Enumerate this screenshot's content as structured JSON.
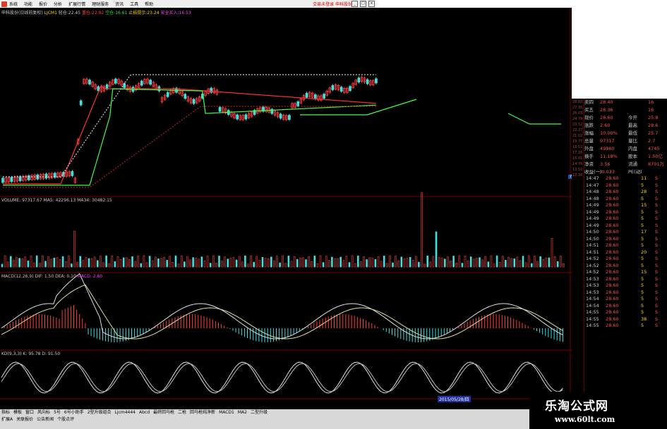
{
  "menubar": {
    "items": [
      "系统",
      "功能",
      "报价",
      "分析",
      "扩展行情",
      "理财服务",
      "资讯",
      "工具",
      "帮助"
    ],
    "right_text": "交易未登录 申科股份"
  },
  "price_panel": {
    "title": "申科股份(日线前复权)",
    "indicator_label": "LJCM1",
    "a_label": "轻仓",
    "a_val": "22.45",
    "b_label": "重仓",
    "b_val": "22.92",
    "c_label": "空仓",
    "c_val": "16.61",
    "d_label": "止损提示",
    "d_val": "23.24",
    "e_label": "安全买入",
    "e_val": "16.53"
  },
  "volume_panel": {
    "label": "VOLUME",
    "vol": "97317.67",
    "ma5_label": "MA5",
    "ma5": "42296.13",
    "ma34_label": "MA34",
    "ma34": "30482.15"
  },
  "macd_panel": {
    "label": "MACD(12,26,9)",
    "dif_label": "DIF",
    "dif": "1.50",
    "dea_label": "DEA",
    "dea": "0.10",
    "macd_label": "MACD",
    "macd": "2.80"
  },
  "kdj_panel": {
    "label": "KD(9,3,3)",
    "k_label": "K",
    "k": "95.78",
    "d_label": "D",
    "d": "91.50"
  },
  "axis_ticks": [
    "28.60",
    "27.35",
    "26.03",
    "24.79",
    "23.52",
    "22.27",
    "21.02",
    "19.77",
    "18.52",
    "17.26",
    "16.01",
    "14.76",
    "13.51",
    "12.26"
  ],
  "marker": "7.98",
  "quote": [
    {
      "l1": "卖四",
      "v1": "28.40",
      "r1": "",
      "r2": "16"
    },
    {
      "l1": "买五",
      "v1": "28.36",
      "r1": "",
      "r2": "16"
    },
    {
      "l1": "现价",
      "v1": "28.60",
      "r1": "今开",
      "r2": "25.8"
    },
    {
      "l1": "涨跌",
      "v1": "2.60",
      "r1": "最高",
      "r2": "28.6"
    },
    {
      "l1": "涨幅",
      "v1": "10.00%",
      "r1": "最低",
      "r2": "25.7"
    },
    {
      "l1": "总量",
      "v1": "97317",
      "r1": "量比",
      "r2": "2.7"
    },
    {
      "l1": "外盘",
      "v1": "49860",
      "r1": "内盘",
      "r2": "4745"
    },
    {
      "l1": "换手",
      "v1": "11.18%",
      "r1": "股本",
      "r2": "1.50亿"
    },
    {
      "l1": "净资",
      "v1": "3.56",
      "r1": "流通",
      "r2": "8701万"
    },
    {
      "l1": "收益(一)",
      "v1": "-0.033",
      "r1": "PE(动)",
      "r2": ""
    }
  ],
  "ticks": [
    {
      "t": "14:47",
      "p": "28.60",
      "v": "11",
      "d": "S"
    },
    {
      "t": "14:47",
      "p": "28.60",
      "v": "5",
      "d": "S"
    },
    {
      "t": "14:48",
      "p": "28.60",
      "v": "28",
      "d": "S"
    },
    {
      "t": "14:48",
      "p": "28.60",
      "v": "5",
      "d": "S"
    },
    {
      "t": "14:49",
      "p": "28.60",
      "v": "15",
      "d": "S"
    },
    {
      "t": "14:49",
      "p": "28.60",
      "v": "5",
      "d": "S"
    },
    {
      "t": "14:49",
      "p": "28.60",
      "v": "5",
      "d": "S"
    },
    {
      "t": "14:49",
      "p": "28.60",
      "v": "5",
      "d": "S"
    },
    {
      "t": "14:50",
      "p": "28.60",
      "v": "17",
      "d": "S"
    },
    {
      "t": "14:50",
      "p": "28.60",
      "v": "5",
      "d": "S"
    },
    {
      "t": "14:51",
      "p": "28.60",
      "v": "5",
      "d": "S"
    },
    {
      "t": "14:51",
      "p": "28.60",
      "v": "20",
      "d": "S"
    },
    {
      "t": "14:52",
      "p": "28.60",
      "v": "5",
      "d": "S"
    },
    {
      "t": "14:52",
      "p": "28.60",
      "v": "5",
      "d": "S"
    },
    {
      "t": "14:52",
      "p": "28.60",
      "v": "15",
      "d": "S"
    },
    {
      "t": "14:53",
      "p": "28.60",
      "v": "5",
      "d": "S"
    },
    {
      "t": "14:53",
      "p": "28.60",
      "v": "5",
      "d": "S"
    },
    {
      "t": "14:53",
      "p": "28.60",
      "v": "5",
      "d": "S"
    },
    {
      "t": "14:54",
      "p": "28.60",
      "v": "5",
      "d": "S"
    },
    {
      "t": "14:54",
      "p": "28.60",
      "v": "5",
      "d": "S"
    },
    {
      "t": "14:55",
      "p": "28.60",
      "v": "5",
      "d": "S"
    },
    {
      "t": "14:55",
      "p": "28.60",
      "v": "38",
      "d": "S"
    },
    {
      "t": "14:55",
      "p": "28.60",
      "v": "5",
      "d": "S"
    }
  ],
  "tabs_row1": [
    "指标",
    "模板",
    "窗口",
    "风向标",
    "5号",
    "6号小助手",
    "2型升级组合",
    "Ljcm4444",
    "Abcd",
    "最终回马枪",
    "二枪",
    "回马枪纯净新",
    "MACD1",
    "MA2",
    "二型升级"
  ],
  "tabs_row2": [
    "扩展A",
    "关联报价",
    "公告新闻",
    "个股点评"
  ],
  "date_label": "2015/05/28/四",
  "watermark": {
    "line1": "乐淘公式网",
    "line2": "www.60lt.com"
  }
}
